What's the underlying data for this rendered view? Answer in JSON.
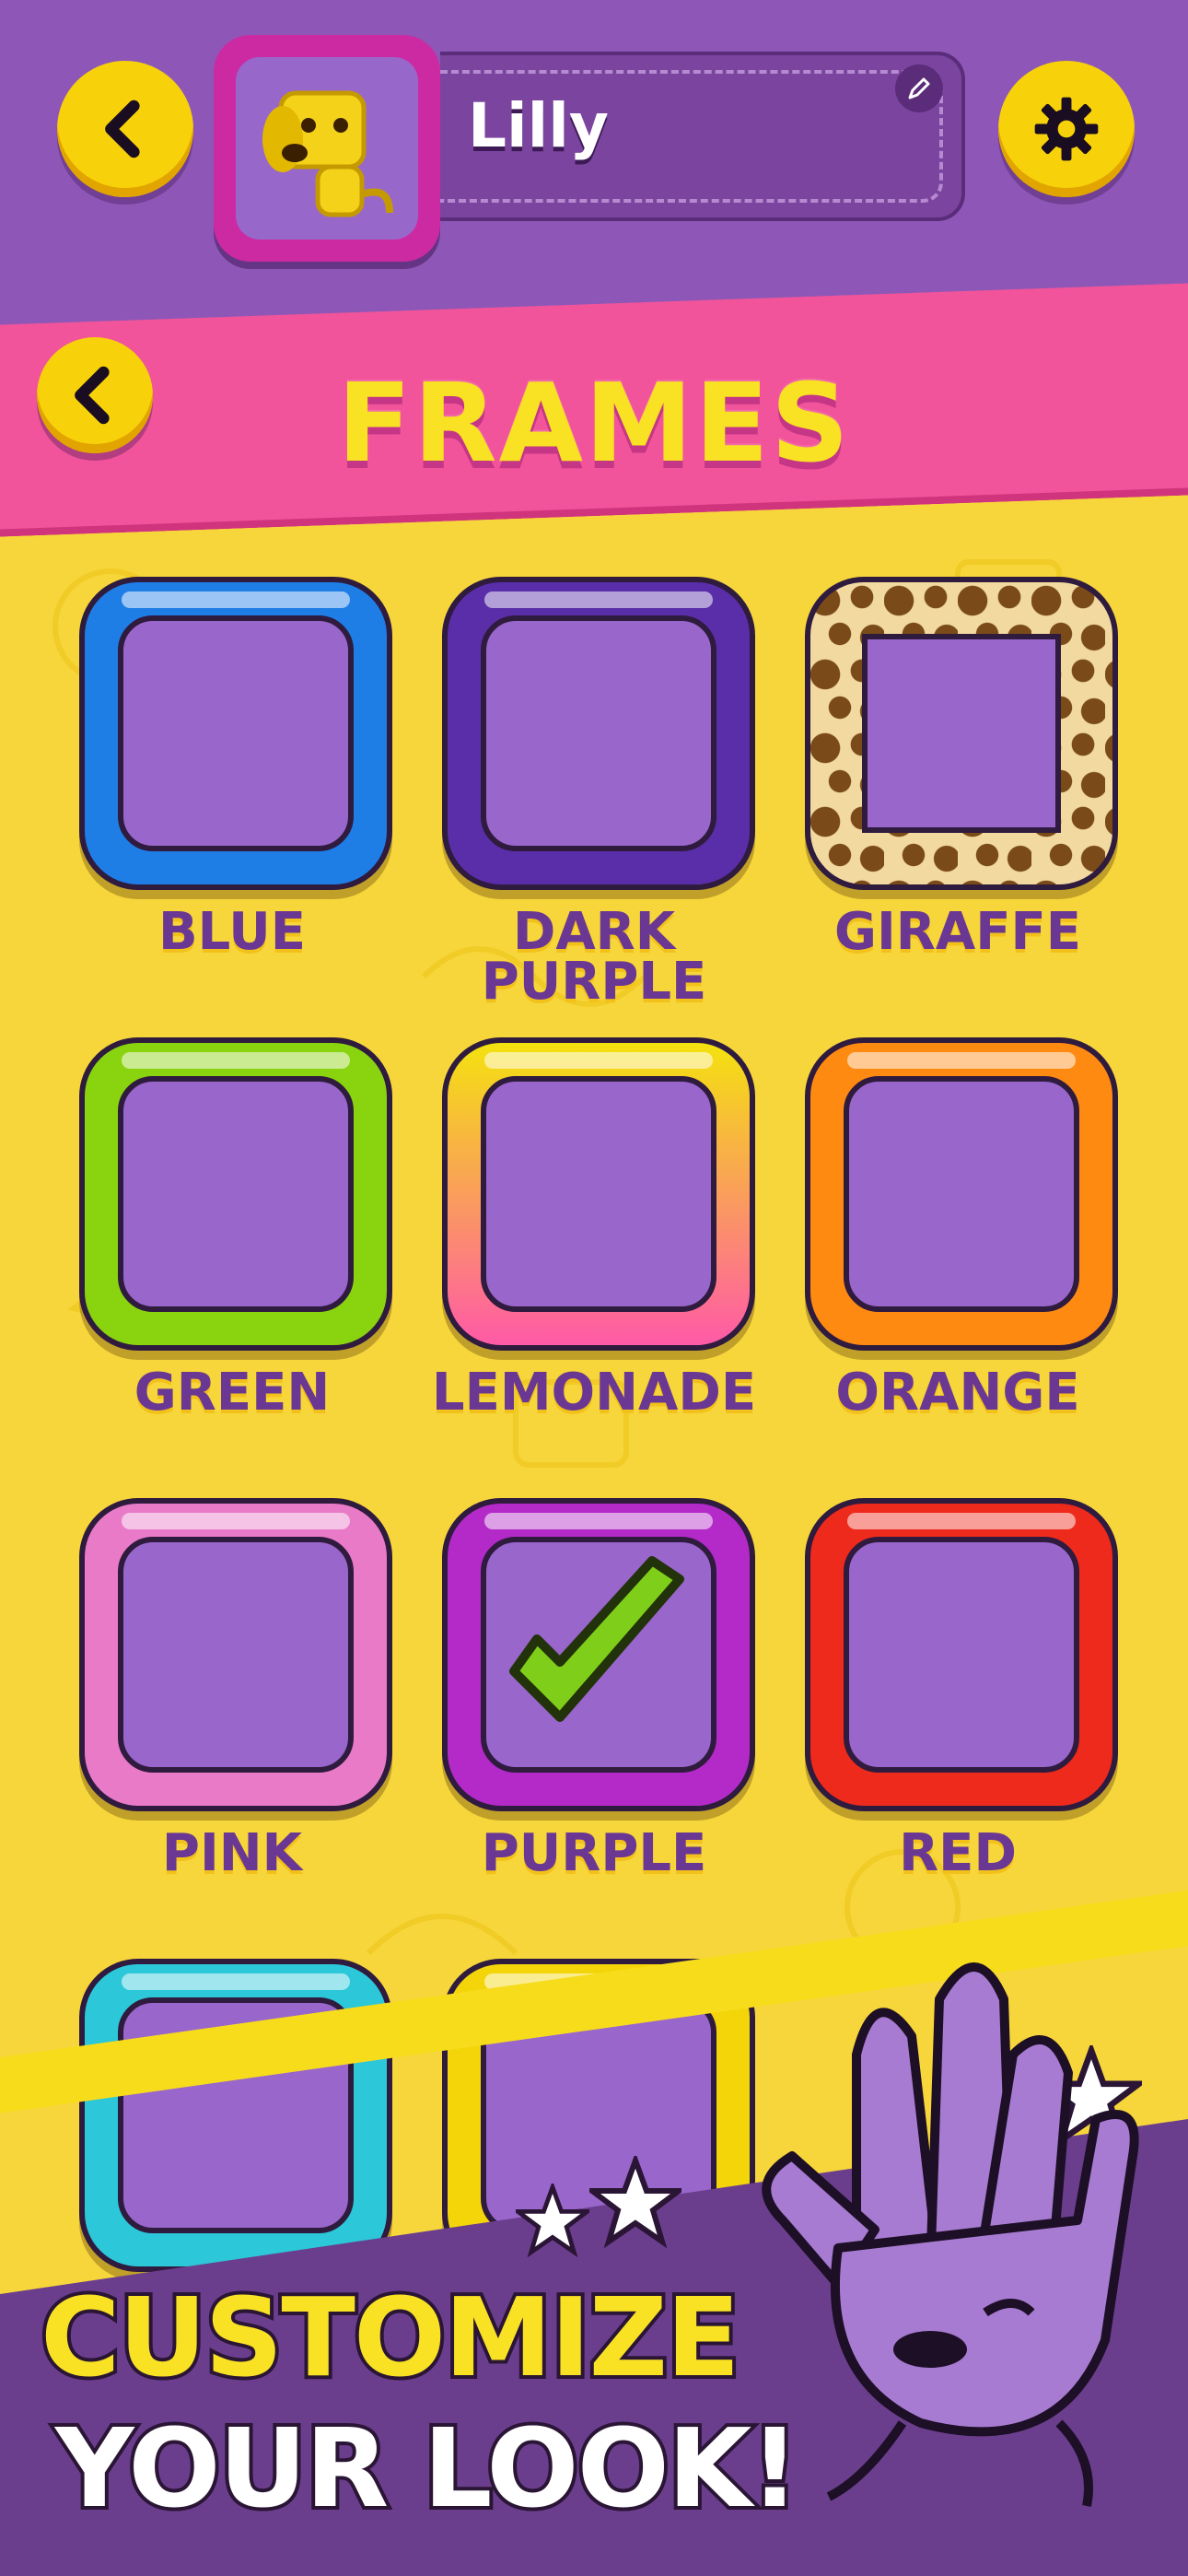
{
  "profile": {
    "name": "Lilly"
  },
  "screen": {
    "title": "FRAMES"
  },
  "frames": [
    {
      "label": "BLUE",
      "color": "#1f7ee6",
      "selected": false
    },
    {
      "label": "DARK PURPLE",
      "color": "#5a2ea8",
      "selected": false
    },
    {
      "label": "GIRAFFE",
      "color": "giraffe-pattern",
      "selected": false
    },
    {
      "label": "GREEN",
      "color": "#8ad30f",
      "selected": false
    },
    {
      "label": "LEMONADE",
      "color": "#ff5aa7",
      "selected": false
    },
    {
      "label": "ORANGE",
      "color": "#ff8a12",
      "selected": false
    },
    {
      "label": "PINK",
      "color": "#e97ac7",
      "selected": false
    },
    {
      "label": "PURPLE",
      "color": "#b32ac8",
      "selected": true
    },
    {
      "label": "RED",
      "color": "#ee2a1c",
      "selected": false
    },
    {
      "label": "",
      "color": "#2cc7d9",
      "selected": false
    },
    {
      "label": "",
      "color": "#f4d50a",
      "selected": false
    }
  ],
  "promo": {
    "line1": "CUSTOMIZE",
    "line2": "YOUR LOOK!"
  },
  "icons": {
    "back": "chevron-left-icon",
    "settings": "gear-icon",
    "edit": "pencil-icon",
    "check": "checkmark-icon"
  }
}
